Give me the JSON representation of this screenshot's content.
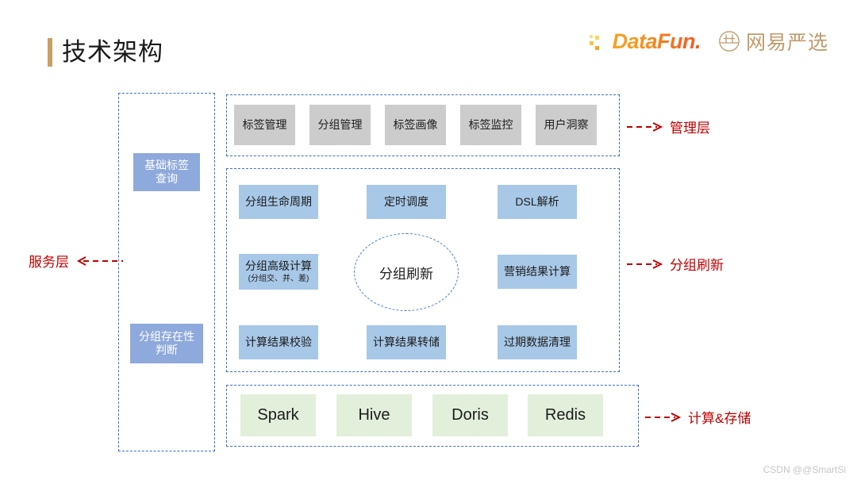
{
  "header": {
    "title": "技术架构",
    "brand_datafun": "DataFun.",
    "brand_yanxuan": "网易严选",
    "accent_color": "#C9A063",
    "datafun_color": "#F7931E",
    "yanxuan_color": "#C19A6B"
  },
  "service_layer": {
    "label": "服务层",
    "items": [
      {
        "label": "基础标签\n查询",
        "line1": "基础标签",
        "line2": "查询"
      },
      {
        "label": "分组存在性\n判断",
        "line1": "分组存在性",
        "line2": "判断"
      }
    ],
    "box_color": "#8EA9DB"
  },
  "management_layer": {
    "annotation": "管理层",
    "box_color": "#CCCCCC",
    "items": [
      {
        "label": "标签管理"
      },
      {
        "label": "分组管理"
      },
      {
        "label": "标签画像"
      },
      {
        "label": "标签监控"
      },
      {
        "label": "用户洞察"
      }
    ]
  },
  "refresh_layer": {
    "annotation": "分组刷新",
    "center": {
      "label": "分组刷新"
    },
    "box_color": "#A7C8E7",
    "items": [
      {
        "label": "分组生命周期"
      },
      {
        "label": "定时调度"
      },
      {
        "label": "DSL解析"
      },
      {
        "label": "分组高级计算",
        "sub": "(分组交、并、差)"
      },
      {
        "label": "营销结果计算"
      },
      {
        "label": "计算结果校验"
      },
      {
        "label": "计算结果转储"
      },
      {
        "label": "过期数据清理"
      }
    ]
  },
  "compute_storage_layer": {
    "annotation": "计算&存储",
    "box_color": "#E2EFDA",
    "items": [
      {
        "label": "Spark"
      },
      {
        "label": "Hive"
      },
      {
        "label": "Doris"
      },
      {
        "label": "Redis"
      }
    ]
  },
  "watermark": {
    "text": "CSDN @@SmartSi"
  },
  "colors": {
    "dashed_border": "#3F6FC4",
    "annotation_red": "#C00000"
  }
}
